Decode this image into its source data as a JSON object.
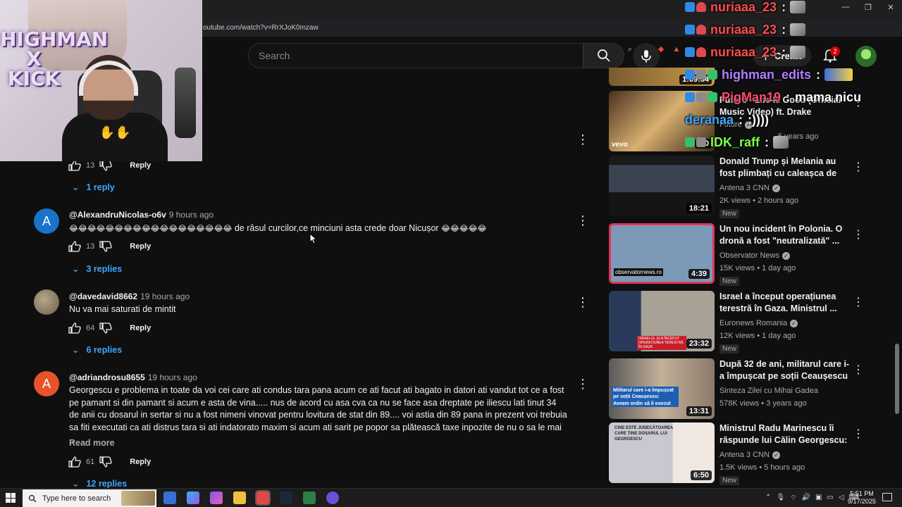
{
  "browser": {
    "url": "outube.com/watch?v=RrXJoK0mzaw",
    "window_controls": [
      "—",
      "❐",
      "✕"
    ]
  },
  "header": {
    "search_placeholder": "Search",
    "create_label": "Create",
    "notification_count": "2"
  },
  "chat": [
    {
      "user": "nuriaaa_23",
      "message": "",
      "color": "#ff4d4d",
      "emote": true
    },
    {
      "user": "nuriaaa_23",
      "message": "",
      "color": "#ff4d4d",
      "emote": true
    },
    {
      "user": "nuriaaa_23",
      "message": "",
      "color": "#ff4d4d",
      "emote": true
    },
    {
      "user": "highman_edits",
      "message": "",
      "color": "#b57cff",
      "emote": true
    },
    {
      "user": "PigMan19",
      "message": "mama nicu",
      "color": "#ff4d6a",
      "emote": false
    },
    {
      "user": "deranaa",
      "message": ":))))",
      "color": "#3ea6ff",
      "emote": false
    },
    {
      "user": "IDK_raff",
      "message": "",
      "color": "#7cff4d",
      "emote": true
    }
  ],
  "comments": [
    {
      "likes": "13",
      "reply_label": "Reply",
      "replies_label": "1 reply"
    },
    {
      "avatar_letter": "A",
      "avatar_color": "#1a73c8",
      "author": "@AlexandruNicolas-o6v",
      "time": "9 hours ago",
      "emoji_prefix": "😂😂😂😂😂😂😂😂😂😂😂😂😂😂😂😂😂😂",
      "text": "de râsul curcilor,ce minciuni asta crede doar Nicușor",
      "emoji_suffix": "😂😂😂😂😂",
      "likes": "13",
      "reply_label": "Reply",
      "replies_label": "3 replies"
    },
    {
      "author": "@davedavid8662",
      "time": "19 hours ago",
      "text": "Nu va mai saturati de mintit",
      "likes": "64",
      "reply_label": "Reply",
      "replies_label": "6 replies"
    },
    {
      "avatar_letter": "A",
      "avatar_color": "#e8532a",
      "author": "@adriandrosu8655",
      "time": "19 hours ago",
      "text": "Georgescu e problema in toate da voi cei care ati condus tara pana acum ce ati facut ati bagato in datori ati vandut tot ce a fost pe pamant si din pamant si acum e asta de vina..... nus de acord cu asa cva ca nu se face asa dreptate pe iliescu lati tinut 34 de anii cu dosarul in sertar si nu a fost nimeni vinovat pentru lovitura de stat din 89.... voi astia din 89 pana in prezent voi trebuia sa fiti executati ca ati distrus tara si ati indatorato maxim si acum ati sarit pe popor sa plătească taxe inpozite de nu o sa le mai ..",
      "read_more": "Read more",
      "likes": "61",
      "reply_label": "Reply",
      "replies_label": "12 replies"
    }
  ],
  "sidebar": [
    {
      "duration": "1:09:34",
      "partial": true
    },
    {
      "title": "Future - Life Is Good (Official Music Video) ft. Drake",
      "channel": "Future",
      "meta": "5 years ago",
      "thumb_label": "vevo",
      "duration": "5:0"
    },
    {
      "title": "Donald Trump și Melania au fost plimbați cu caleașca de a...",
      "channel": "Antena 3 CNN",
      "meta": "2K views • 2 hours ago",
      "duration": "18:21",
      "new": "New"
    },
    {
      "title": "Un nou incident în Polonia. O dronă a fost \"neutralizată\" ...",
      "channel": "Observator News",
      "meta": "15K views • 1 day ago",
      "thumb_label": "observatornews.ro",
      "duration": "4:39",
      "new": "New"
    },
    {
      "title": "Israel a început operațiunea terestră în Gaza. Ministrul ...",
      "channel": "Euronews Romania",
      "meta": "12K views • 1 day ago",
      "thumb_label": "ISRAELUL ȘI-A ÎNCEPUT OPERAȚIUNEA TERESTRĂ ÎN GAZA",
      "duration": "23:32",
      "new": "New"
    },
    {
      "title": "După 32 de ani, militarul care i-a împușcat pe soții Ceaușescu ...",
      "channel": "Sinteza Zilei cu Mihai Gadea",
      "meta": "578K views • 3 years ago",
      "thumb_label": "Militarul care i-a împușcat pe soții Ceaușescu:",
      "thumb_label2": "Aveam ordin să îi execut",
      "duration": "13:31"
    },
    {
      "title": "Ministrul Radu Marinescu îi răspunde lui Călin Georgescu: ...",
      "channel": "Antena 3 CNN",
      "meta": "1.5K views • 5 hours ago",
      "thumb_label": "CINE ESTE JUDECĂTOAREA CARE ȚINE DOSARUL LUI GEORGESCU",
      "duration": "6:50",
      "new": "New"
    }
  ],
  "taskbar": {
    "search_placeholder": "Type here to search",
    "time": "5:51 PM",
    "date": "9/17/2025"
  },
  "webcam": {
    "logo_text": "HIGHMAN X KICK"
  }
}
